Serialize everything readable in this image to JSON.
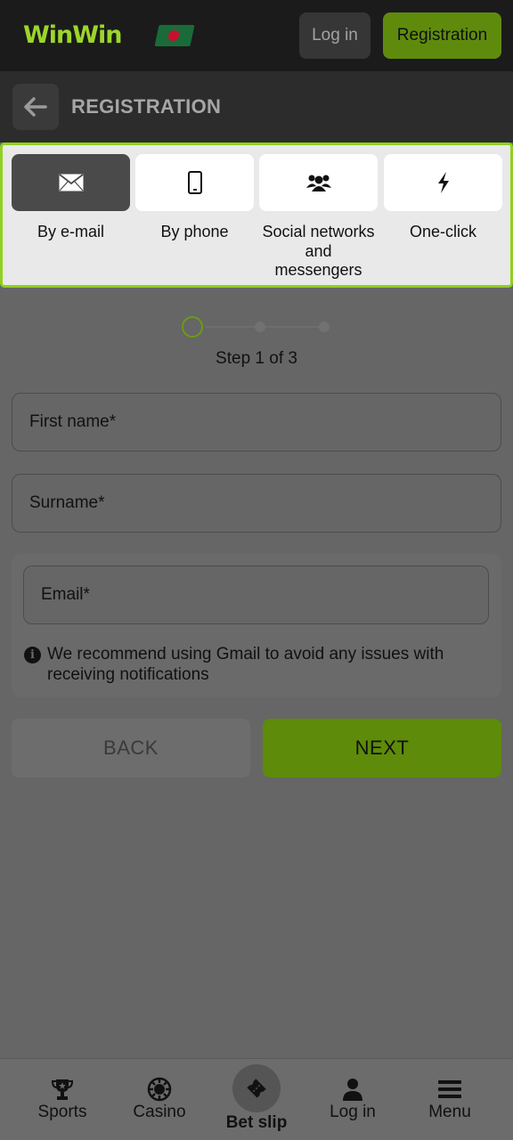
{
  "header": {
    "logo": {
      "part1": "Win",
      "part2": "Win"
    },
    "login_label": "Log in",
    "registration_label": "Registration"
  },
  "subheader": {
    "title": "REGISTRATION"
  },
  "methods": [
    {
      "label": "By e-mail",
      "icon": "envelope-icon",
      "active": true
    },
    {
      "label": "By phone",
      "icon": "phone-icon",
      "active": false
    },
    {
      "label": "Social networks and messengers",
      "icon": "users-icon",
      "active": false
    },
    {
      "label": "One-click",
      "icon": "lightning-icon",
      "active": false
    }
  ],
  "stepper": {
    "current": 1,
    "total": 3,
    "text": "Step 1 of 3"
  },
  "form": {
    "first_name_placeholder": "First name*",
    "surname_placeholder": "Surname*",
    "email_placeholder": "Email*",
    "hint": "We recommend using Gmail to avoid any issues with receiving notifications"
  },
  "buttons": {
    "back": "BACK",
    "next": "NEXT"
  },
  "bottom_nav": [
    {
      "label": "Sports",
      "icon": "trophy-icon"
    },
    {
      "label": "Casino",
      "icon": "casino-chip-icon"
    },
    {
      "label": "Bet slip",
      "icon": "ticket-icon"
    },
    {
      "label": "Log in",
      "icon": "user-icon"
    },
    {
      "label": "Menu",
      "icon": "hamburger-menu-icon"
    }
  ],
  "colors": {
    "accent": "#8fd11f",
    "accent_dark": "#5e8b0a",
    "overlay_bg": "#666666",
    "header_bg": "#1b1b1b"
  }
}
